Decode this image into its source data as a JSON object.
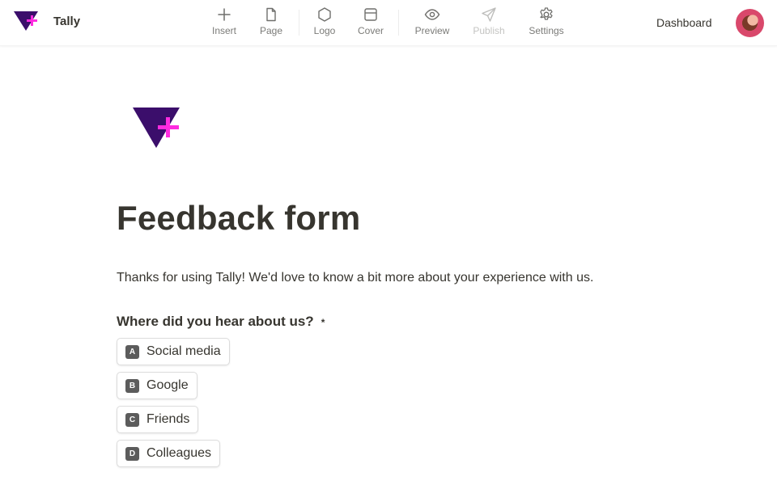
{
  "header": {
    "brand_name": "Tally",
    "toolbar": [
      {
        "id": "insert",
        "label": "Insert",
        "icon": "plus-icon",
        "disabled": false
      },
      {
        "id": "page",
        "label": "Page",
        "icon": "page-icon",
        "disabled": false
      },
      {
        "id": "logo",
        "label": "Logo",
        "icon": "hexagon-icon",
        "disabled": false
      },
      {
        "id": "cover",
        "label": "Cover",
        "icon": "cover-icon",
        "disabled": false
      },
      {
        "id": "preview",
        "label": "Preview",
        "icon": "eye-icon",
        "disabled": false
      },
      {
        "id": "publish",
        "label": "Publish",
        "icon": "send-icon",
        "disabled": true
      },
      {
        "id": "settings",
        "label": "Settings",
        "icon": "gear-icon",
        "disabled": false
      }
    ],
    "dashboard_label": "Dashboard",
    "avatar_icon": "user-avatar"
  },
  "colors": {
    "logo_triangle": "#3b0e6b",
    "logo_plus": "#ff2be0",
    "text": "#37352f",
    "muted": "#7b7b78",
    "disabled": "#c4c4c2"
  },
  "form": {
    "title": "Feedback form",
    "description": "Thanks for using Tally! We'd love to know a bit more about your experience with us.",
    "question": {
      "label": "Where did you hear about us?",
      "required_mark": "*",
      "options": [
        {
          "key": "A",
          "label": "Social media"
        },
        {
          "key": "B",
          "label": "Google"
        },
        {
          "key": "C",
          "label": "Friends"
        },
        {
          "key": "D",
          "label": "Colleagues"
        }
      ]
    }
  }
}
